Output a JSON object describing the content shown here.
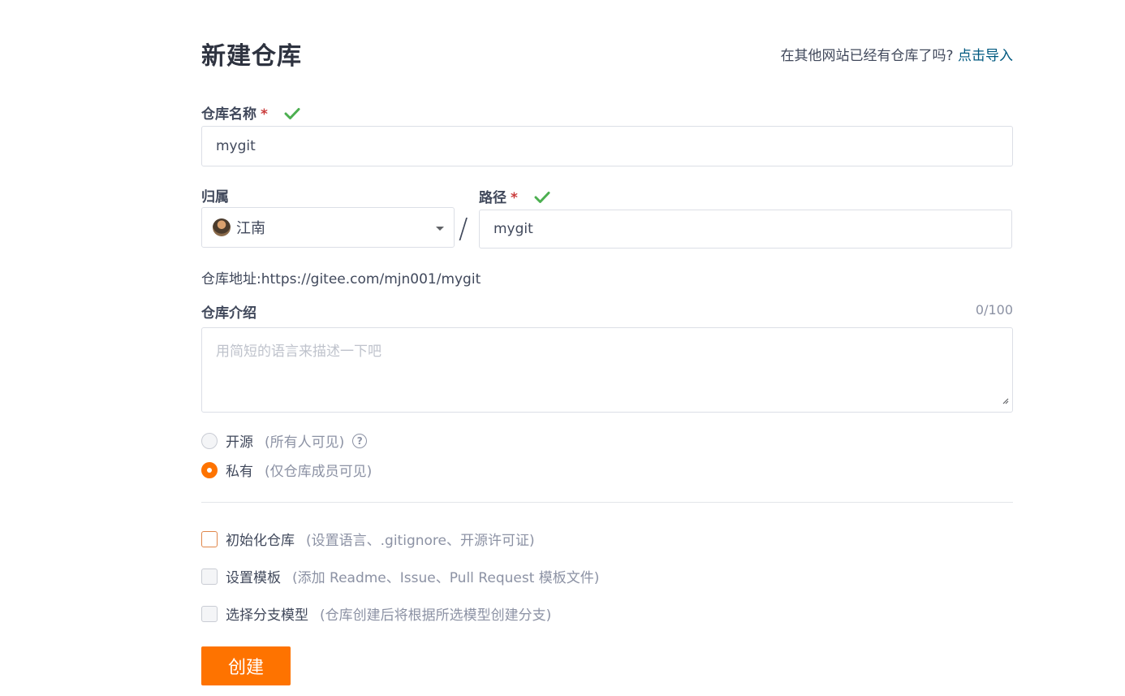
{
  "header": {
    "title": "新建仓库",
    "import_prompt": "在其他网站已经有仓库了吗?",
    "import_link": "点击导入"
  },
  "repo_name": {
    "label": "仓库名称",
    "required_mark": "*",
    "value": "mygit",
    "valid": true
  },
  "owner": {
    "label": "归属",
    "selected": "江南"
  },
  "path_separator": "/",
  "path": {
    "label": "路径",
    "required_mark": "*",
    "value": "mygit",
    "valid": true
  },
  "repo_address": {
    "label": "仓库地址:",
    "value": "https://gitee.com/mjn001/mygit"
  },
  "description": {
    "label": "仓库介绍",
    "counter": "0/100",
    "placeholder": "用简短的语言来描述一下吧"
  },
  "visibility": {
    "options": [
      {
        "label": "开源",
        "hint": "(所有人可见)",
        "checked": false
      },
      {
        "label": "私有",
        "hint": "(仅仓库成员可见)",
        "checked": true
      }
    ]
  },
  "options": {
    "items": [
      {
        "label": "初始化仓库",
        "hint": "(设置语言、.gitignore、开源许可证)",
        "checked": false
      },
      {
        "label": "设置模板",
        "hint": "(添加 Readme、Issue、Pull Request 模板文件)",
        "checked": false
      },
      {
        "label": "选择分支模型",
        "hint": "(仓库创建后将根据所选模型创建分支)",
        "checked": false
      }
    ]
  },
  "submit": {
    "label": "创建"
  },
  "colors": {
    "accent": "#fe7300",
    "link": "#005980",
    "valid_check": "#4caf50",
    "required": "#ca3c3c"
  }
}
